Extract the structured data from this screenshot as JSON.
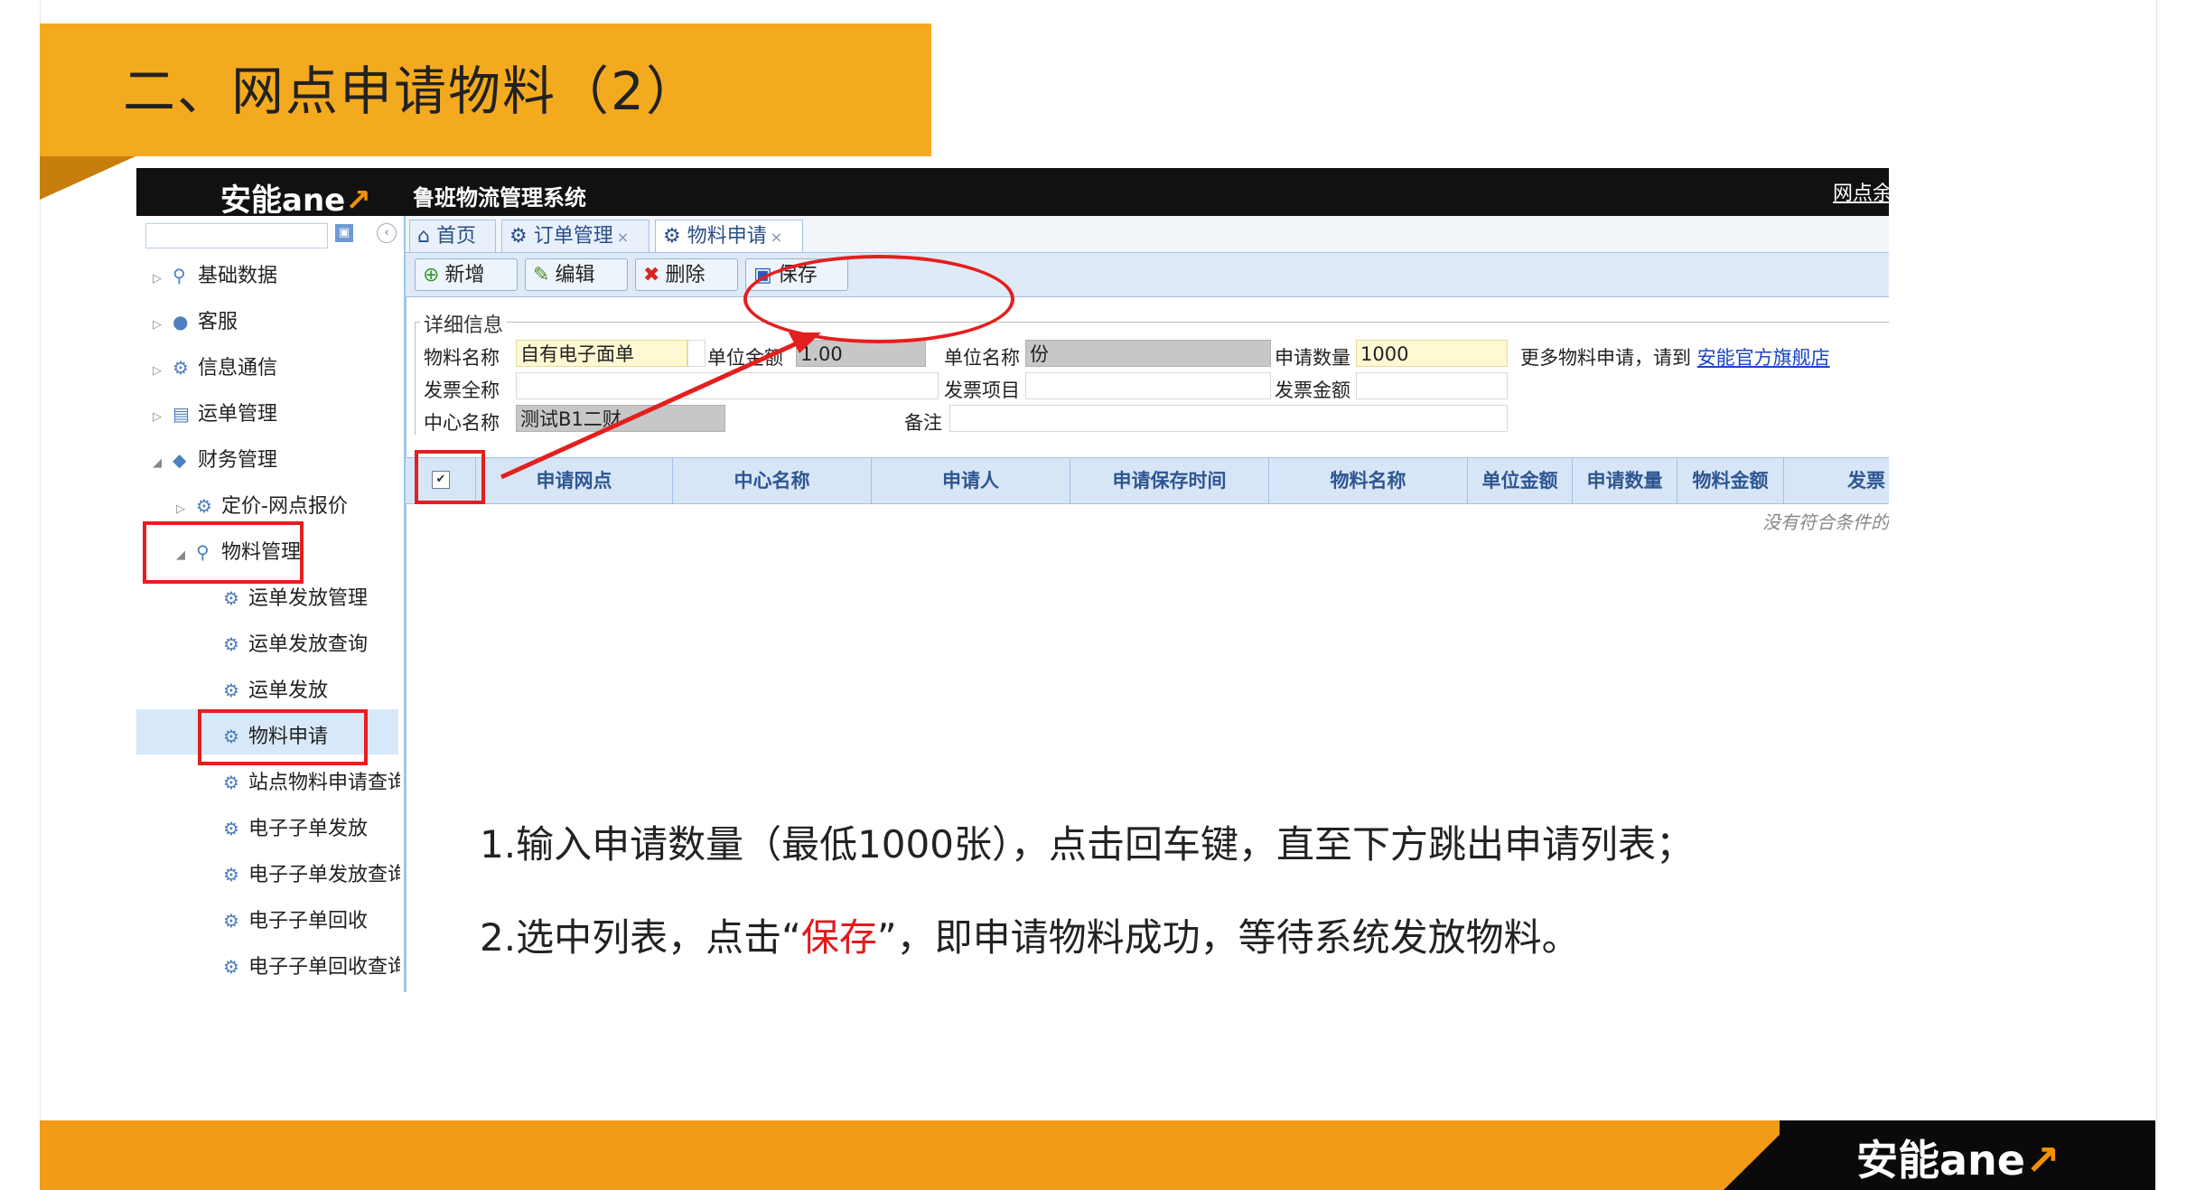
{
  "slide": {
    "title": "二、网点申请物料（2）",
    "footer_logo_text": "安能ane",
    "footer_logo_arrow": "↗"
  },
  "app": {
    "logo_text": "安能ane",
    "logo_arrow": "↗",
    "system_title": "鲁班物流管理系统",
    "header_right_link": "网点余"
  },
  "sidebar": {
    "items": [
      {
        "label": "基础数据"
      },
      {
        "label": "客服"
      },
      {
        "label": "信息通信"
      },
      {
        "label": "运单管理"
      },
      {
        "label": "财务管理"
      },
      {
        "label": "定价-网点报价"
      },
      {
        "label": "物料管理"
      },
      {
        "label": "运单发放管理"
      },
      {
        "label": "运单发放查询"
      },
      {
        "label": "运单发放"
      },
      {
        "label": "物料申请"
      },
      {
        "label": "站点物料申请查询"
      },
      {
        "label": "电子子单发放"
      },
      {
        "label": "电子子单发放查询"
      },
      {
        "label": "电子子单回收"
      },
      {
        "label": "电子子单回收查询"
      }
    ]
  },
  "tabs": [
    {
      "label": "首页"
    },
    {
      "label": "订单管理"
    },
    {
      "label": "物料申请"
    }
  ],
  "toolbar": {
    "add_label": "新增",
    "edit_label": "编辑",
    "delete_label": "删除",
    "save_label": "保存"
  },
  "form": {
    "legend": "详细信息",
    "material_name_label": "物料名称",
    "material_name_value": "自有电子面单",
    "unit_amount_label": "单位金额",
    "unit_amount_value": "1.00",
    "unit_name_label": "单位名称",
    "unit_name_value": "份",
    "apply_qty_label": "申请数量",
    "apply_qty_value": "1000",
    "more_text": "更多物料申请，请到",
    "more_link": "安能官方旗舰店",
    "invoice_name_label": "发票全称",
    "invoice_item_label": "发票项目",
    "invoice_amount_label": "发票金额",
    "center_name_label": "中心名称",
    "center_name_value": "测试B1二财",
    "remark_label": "备注"
  },
  "grid": {
    "columns": [
      "申请网点",
      "中心名称",
      "申请人",
      "申请保存时间",
      "物料名称",
      "单位金额",
      "申请数量",
      "物料金额",
      "发票"
    ],
    "empty_message": "没有符合条件的"
  },
  "instructions": {
    "step1": "1.输入申请数量（最低1000张），点击回车键，直至下方跳出申请列表；",
    "step2_prefix": "2.选中列表，点击“",
    "step2_highlight": "保存",
    "step2_suffix": "”，即申请物料成功，等待系统发放物料。"
  },
  "colors": {
    "title_bar": "#f4aa1f",
    "footer_bar": "#f39a16",
    "annotation_red": "#e41f1f"
  }
}
